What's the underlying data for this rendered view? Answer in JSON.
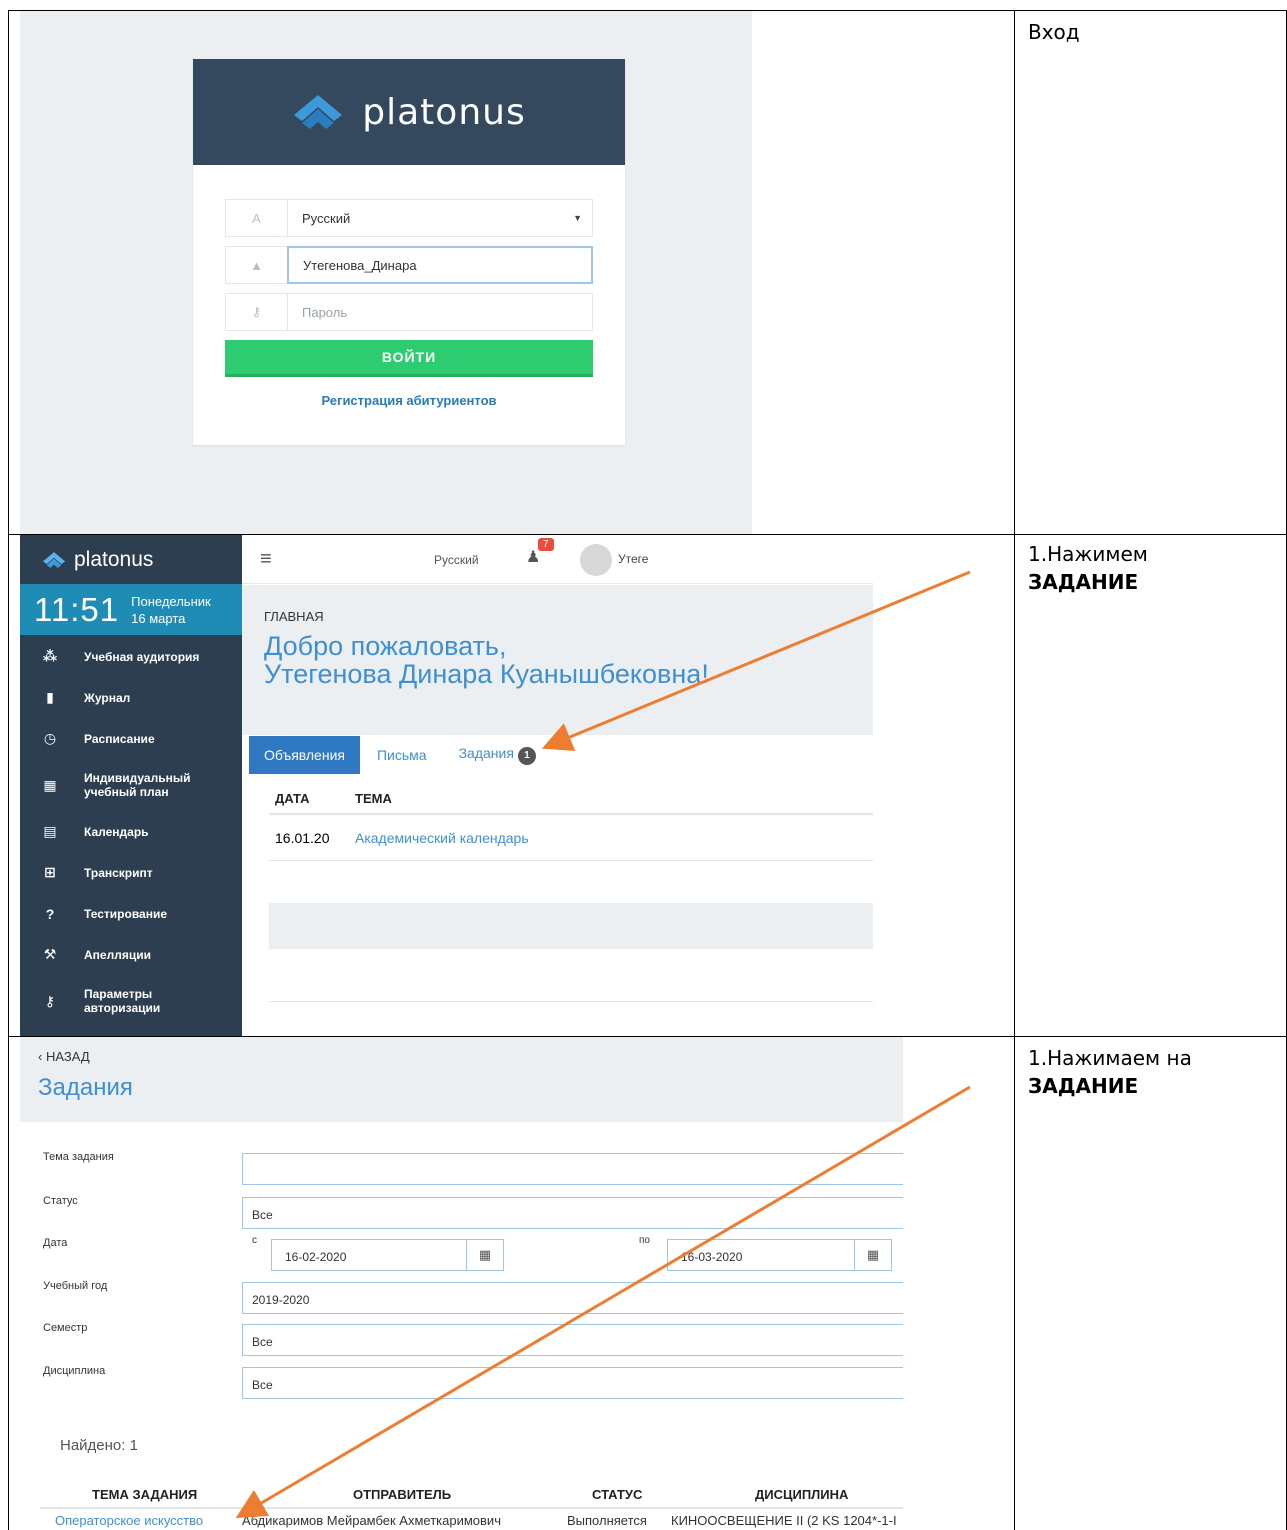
{
  "notes": {
    "row1": "Вход",
    "row2_prefix": "1.Нажимем ",
    "row2_bold": "ЗАДАНИЕ",
    "row3_prefix": "1.Нажимаем на ",
    "row3_bold": "ЗАДАНИЕ"
  },
  "login": {
    "brand": "platonus",
    "language": "Русский",
    "username": "Утегенова_Динара",
    "password_placeholder": "Пароль",
    "submit": "ВОЙТИ",
    "register_link": "Регистрация абитуриентов"
  },
  "dashboard": {
    "brand": "platonus",
    "time": "11:51",
    "weekday": "Понедельник",
    "date": "16 марта",
    "menu": [
      {
        "icon": "users-icon",
        "glyph": "⁂",
        "label": "Учебная аудитория"
      },
      {
        "icon": "book-icon",
        "glyph": "▮",
        "label": "Журнал"
      },
      {
        "icon": "clock-icon",
        "glyph": "◷",
        "label": "Расписание"
      },
      {
        "icon": "grid-icon",
        "glyph": "▦",
        "label": "Индивидуальный учебный план"
      },
      {
        "icon": "calendar-icon",
        "glyph": "▤",
        "label": "Календарь"
      },
      {
        "icon": "table-icon",
        "glyph": "⊞",
        "label": "Транскрипт"
      },
      {
        "icon": "question-icon",
        "glyph": "?",
        "label": "Тестирование"
      },
      {
        "icon": "gavel-icon",
        "glyph": "⚒",
        "label": "Апелляции"
      },
      {
        "icon": "key-icon",
        "glyph": "⚷",
        "label": "Параметры авторизации"
      }
    ],
    "topbar": {
      "language": "Русский",
      "notifications": "7",
      "user_short": "Утеге"
    },
    "breadcrumb": "ГЛАВНАЯ",
    "welcome_line1": "Добро пожаловать,",
    "welcome_line2": "Утегенова Динара Куанышбековна!",
    "tabs": {
      "announcements": "Объявления",
      "letters": "Письма",
      "tasks": "Задания",
      "tasks_count": "1"
    },
    "table": {
      "col_date": "ДАТА",
      "col_topic": "ТЕМА",
      "rows": [
        {
          "date": "16.01.20",
          "topic": "Академический календарь"
        }
      ]
    }
  },
  "tasks": {
    "back": "НАЗАД",
    "title": "Задания",
    "filters": {
      "topic_label": "Тема задания",
      "topic_value": "",
      "status_label": "Статус",
      "status_value": "Все",
      "date_label": "Дата",
      "date_from_label": "с",
      "date_from": "16-02-2020",
      "date_to_label": "по",
      "date_to": "16-03-2020",
      "year_label": "Учебный год",
      "year_value": "2019-2020",
      "semester_label": "Семестр",
      "semester_value": "Все",
      "discipline_label": "Дисциплина",
      "discipline_value": "Все"
    },
    "found": "Найдено: 1",
    "columns": {
      "topic": "ТЕМА ЗАДАНИЯ",
      "sender": "ОТПРАВИТЕЛЬ",
      "status": "СТАТУС",
      "discipline": "ДИСЦИПЛИНА"
    },
    "row": {
      "topic": "Операторское искусство",
      "sender": "Абдикаримов Мейрамбек Ахметкаримович",
      "status": "Выполняется",
      "discipline": "КИНООСВЕЩЕНИЕ II (2 KS 1204*-1-I"
    }
  },
  "colors": {
    "sidebar": "#2d3e50",
    "clock": "#1f8cb6",
    "accent_blue": "#3f8fd1",
    "login_button": "#2ecc71",
    "arrow": "#ed7d31"
  }
}
